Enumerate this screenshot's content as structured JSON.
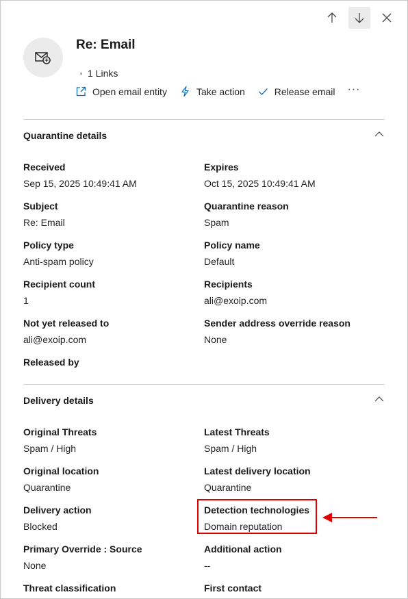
{
  "header": {
    "title": "Re: Email",
    "links_label": "1 Links",
    "actions": [
      {
        "label": "Open email entity",
        "icon": "open-external-icon"
      },
      {
        "label": "Take action",
        "icon": "lightning-icon"
      },
      {
        "label": "Release email",
        "icon": "checkmark-icon"
      }
    ],
    "more_label": "···"
  },
  "nav": {
    "up_icon": "arrow-up-icon",
    "down_icon": "arrow-down-icon",
    "close_icon": "close-icon"
  },
  "quarantine": {
    "title": "Quarantine details",
    "fields": [
      {
        "label": "Received",
        "value": "Sep 15, 2025 10:49:41 AM"
      },
      {
        "label": "Expires",
        "value": "Oct 15, 2025 10:49:41 AM"
      },
      {
        "label": "Subject",
        "value": "Re: Email"
      },
      {
        "label": "Quarantine reason",
        "value": "Spam"
      },
      {
        "label": "Policy type",
        "value": "Anti-spam policy"
      },
      {
        "label": "Policy name",
        "value": "Default"
      },
      {
        "label": "Recipient count",
        "value": "1"
      },
      {
        "label": "Recipients",
        "value": "ali@exoip.com"
      },
      {
        "label": "Not yet released to",
        "value": "ali@exoip.com"
      },
      {
        "label": "Sender address override reason",
        "value": "None"
      },
      {
        "label": "Released by",
        "value": ""
      }
    ]
  },
  "delivery": {
    "title": "Delivery details",
    "fields": [
      {
        "label": "Original Threats",
        "value": "Spam / High"
      },
      {
        "label": "Latest Threats",
        "value": "Spam / High"
      },
      {
        "label": "Original location",
        "value": "Quarantine"
      },
      {
        "label": "Latest delivery location",
        "value": "Quarantine"
      },
      {
        "label": "Delivery action",
        "value": "Blocked"
      },
      {
        "label": "Detection technologies",
        "value": "Domain reputation"
      },
      {
        "label": "Primary Override : Source",
        "value": "None"
      },
      {
        "label": "Additional action",
        "value": "--"
      },
      {
        "label": "Threat classification",
        "value": ""
      },
      {
        "label": "First contact",
        "value": ""
      }
    ]
  },
  "colors": {
    "highlight": "#e00000",
    "accent": "#0f6cbd"
  }
}
